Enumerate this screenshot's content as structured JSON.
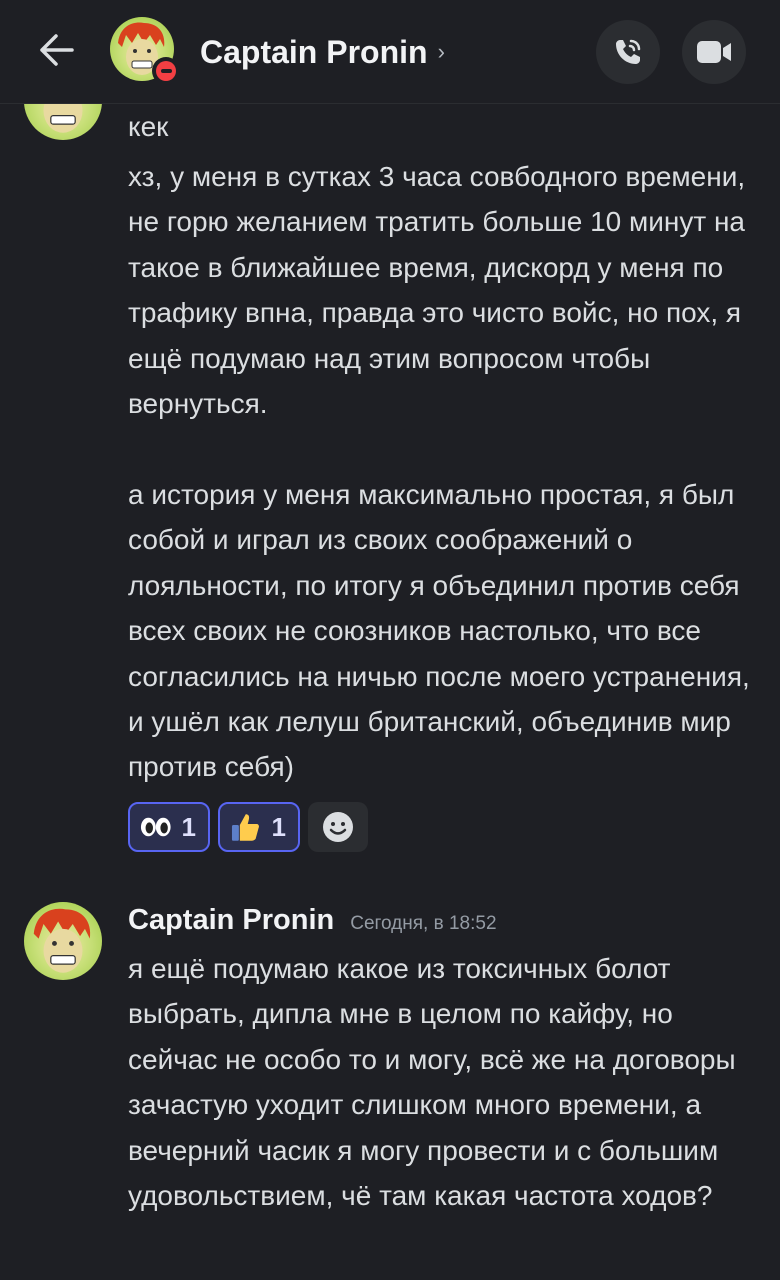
{
  "header": {
    "title": "Captain Pronin",
    "chevron": "›",
    "back_icon": "arrow-left-icon",
    "call_icon": "phone-call-icon",
    "video_icon": "video-camera-icon",
    "status": "do-not-disturb"
  },
  "messages": [
    {
      "continued": true,
      "lines": [
        "кек",
        "хз, у меня в сутках 3 часа совбодного времени, не горю желанием тратить больше 10 минут на такое в ближайшее время, дискорд у меня по трафику впна, правда это чисто войс, но пох, я ещё подумаю над этим вопросом чтобы вернуться.",
        "а история у меня максимально простая, я был собой и играл из своих соображений о лояльности, по итогу я объединил против себя всех своих не союзников настолько, что все согласились  на ничью после моего устранения, и ушёл как лелуш британский, объединив мир против себя)"
      ],
      "reactions": [
        {
          "emoji": "eyes-emoji",
          "count": "1"
        },
        {
          "emoji": "thumbs-up-emoji",
          "count": "1"
        }
      ],
      "add_reaction_icon": "add-reaction-smiley-icon"
    },
    {
      "author": "Captain Pronin",
      "timestamp": "Сегодня, в 18:52",
      "text": "я ещё подумаю какое из токсичных болот выбрать, дипла мне в целом по кайфу, но сейчас не особо то и могу, всё же на договоры зачастую уходит слишком много времени, а вечерний часик я могу провести и с большим удовольствием, чё там какая частота ходов?"
    }
  ],
  "colors": {
    "background": "#1e1f24",
    "reaction_bg": "#2b2f4e",
    "reaction_border": "#5865f2",
    "dnd": "#f23f43"
  }
}
